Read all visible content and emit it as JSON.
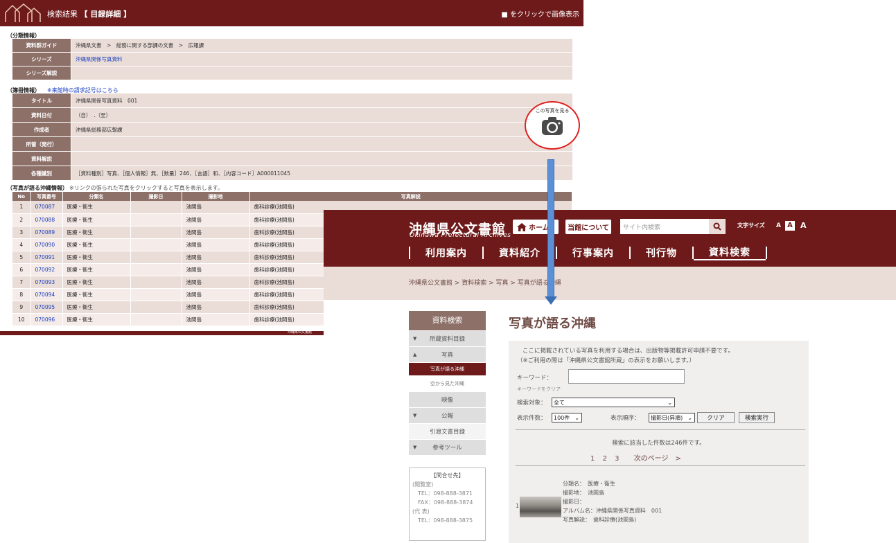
{
  "back": {
    "header": {
      "title": "検索結果",
      "title_bold": "【 目録詳細 】",
      "hint": "■ をクリックで画像表示"
    },
    "classification": {
      "section": "（分類情報）",
      "rows": [
        {
          "key": "資料群ガイド",
          "value": "沖縄県文書　>　総務に関する部課の文書　>　広報課"
        },
        {
          "key": "シリーズ",
          "value": "沖縄県関係写真資料"
        },
        {
          "key": "シリーズ解説",
          "value": ""
        }
      ]
    },
    "volume": {
      "section": "（簿冊情報）",
      "note": "※来館時の請求記号はこちら",
      "rows": [
        {
          "key": "タイトル",
          "value": "沖縄県関係写真資料　001"
        },
        {
          "key": "資料日付",
          "value": "（自）　.（至）"
        },
        {
          "key": "作成者",
          "value": "沖縄県総務部広報課"
        },
        {
          "key": "所管（発行）",
          "value": ""
        },
        {
          "key": "資料解説",
          "value": ""
        },
        {
          "key": "各種識別",
          "value": "［資料種別］写真、［個人情報］無、［数量］246、［言語］和、［内容コード］A000011045"
        }
      ],
      "camera_label": "この写真を見る"
    },
    "photos": {
      "section": "（写真が語る沖縄情報）",
      "note": "※リンクの張られた写真をクリックすると写真を表示します。",
      "columns": [
        "No",
        "写真番号",
        "分類名",
        "撮影日",
        "撮影地",
        "写真解説"
      ],
      "rows": [
        [
          "1",
          "070087",
          "医療・衛生",
          "",
          "池間島",
          "歯科診療(池間島)"
        ],
        [
          "2",
          "070088",
          "医療・衛生",
          "",
          "池間島",
          "歯科診療(池間島)"
        ],
        [
          "3",
          "070089",
          "医療・衛生",
          "",
          "池間島",
          "歯科診療(池間島)"
        ],
        [
          "4",
          "070090",
          "医療・衛生",
          "",
          "池間島",
          "歯科診療(池間島)"
        ],
        [
          "5",
          "070091",
          "医療・衛生",
          "",
          "池間島",
          "歯科診療(池間島)"
        ],
        [
          "6",
          "070092",
          "医療・衛生",
          "",
          "池間島",
          "歯科診療(池間島)"
        ],
        [
          "7",
          "070093",
          "医療・衛生",
          "",
          "池間島",
          "歯科診療(池間島)"
        ],
        [
          "8",
          "070094",
          "医療・衛生",
          "",
          "池間島",
          "歯科診療(池間島)"
        ],
        [
          "9",
          "070095",
          "医療・衛生",
          "",
          "池間島",
          "歯科診療(池間島)"
        ],
        [
          "10",
          "070096",
          "医療・衛生",
          "",
          "池間島",
          "歯科診療(池間島)"
        ]
      ]
    },
    "footer": "沖縄県公文書館"
  },
  "front": {
    "brand": "沖縄県公文書館",
    "brand_en": "Okinawa Prefectural Archives",
    "home_label": "ホーム",
    "about_label": "当館について",
    "search_placeholder": "サイト内検索",
    "fontsize_label": "文字サイズ",
    "fs_small": "A",
    "fs_mid": "A",
    "fs_large": "A",
    "nav": [
      "利用案内",
      "資料紹介",
      "行事案内",
      "刊行物",
      "資料検索"
    ],
    "breadcrumb": "沖縄県公文書館 > 資料検索 > 写真 > 写真が語る沖縄",
    "sidebar": {
      "head": "資料検索",
      "items": [
        "所蔵資料目録",
        "写真",
        "写真が語る沖縄",
        "空から見た沖縄",
        "映像",
        "公報",
        "引渡文書目録",
        "参考ツール"
      ]
    },
    "contact": {
      "title": "【問合せ先】",
      "l1": "(閲覧室)",
      "l2": "TEL：098-888-3871",
      "l3": "FAX：098-888-3874",
      "l4": "(代 表)",
      "l5": "TEL：098-888-3875"
    },
    "page_title": "写真が語る沖縄",
    "panel": {
      "note1": "ここに掲載されている写真を利用する場合は、出版物等掲載許可申請不要です。",
      "note2": "（※ご利用の際は「沖縄県公文書館所蔵」の表示をお願いします。）",
      "keyword_label": "キーワード：",
      "keyword_clear": "キーワードをクリア",
      "target_label": "検索対象：",
      "target_value": "全て",
      "count_label": "表示件数：",
      "count_value": "100件",
      "order_label": "表示順序：",
      "order_value": "撮影日(昇順)",
      "clear_btn": "クリア",
      "search_btn": "検索実行",
      "result_count": "検索に該当した件数は246件です。",
      "pages": [
        "1",
        "2",
        "3"
      ],
      "next": "次のページ　>",
      "result": {
        "num": "1",
        "f1": "分類名：　医療・衛生",
        "f2": "撮影地：　池間島",
        "f3": "撮影日：",
        "f4": "アルバム名：沖縄県関係写真資料　001",
        "f5": "写真解説：　歯科診療(池間島)"
      }
    }
  }
}
